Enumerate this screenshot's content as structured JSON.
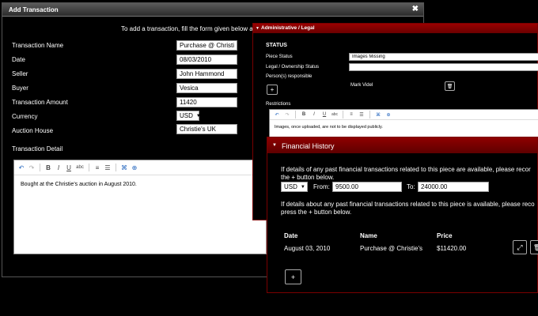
{
  "add_dialog": {
    "title": "Add Transaction",
    "close_glyph": "✖",
    "instructions": "To add a transaction, fill the form given below and click",
    "fields": {
      "name_label": "Transaction Name",
      "name_value": "Purchase @ Christie's",
      "date_label": "Date",
      "date_value": "08/03/2010",
      "seller_label": "Seller",
      "seller_value": "John Hammond",
      "buyer_label": "Buyer",
      "buyer_value": "Vesica",
      "amount_label": "Transaction Amount",
      "amount_value": "11420",
      "currency_label": "Currency",
      "currency_value": "USD",
      "house_label": "Auction House",
      "house_value": "Christie's UK"
    },
    "detail_label": "Transaction Detail",
    "detail_text": "Bought at the Christie's auction in August 2010."
  },
  "admin_panel": {
    "title": "Administrative / Legal",
    "section_title": "STATUS",
    "piece_status_label": "Piece Status",
    "piece_status_value": "Images Missing",
    "legal_label": "Legal / Ownership Status",
    "legal_value": "",
    "persons_label": "Person(s) responsible",
    "person_name": "Mark Videl",
    "restrictions_label": "Restrictions",
    "restrictions_text": "Images, once uploaded, are not to be displayed publicly."
  },
  "financial_panel": {
    "title": "Financial History",
    "intro_line1": "If details of any past financial transactions related to this piece are available, please recor",
    "intro_line2": "the + button below.",
    "currency_value": "USD",
    "from_label": "From:",
    "from_value": "9500.00",
    "to_label": "To:",
    "to_value": "24000.00",
    "info_line1": "If details about any past financial transactions related to this piece is available, please reco",
    "info_line2": "press the + button below.",
    "table": {
      "headers": [
        "Date",
        "Name",
        "Price"
      ],
      "rows": [
        {
          "date": "August 03, 2010",
          "name": "Purchase @ Christie's",
          "price": "$11420.00"
        }
      ]
    }
  },
  "toolbar": {
    "undo": "↶",
    "redo": "↷",
    "bold": "B",
    "italic": "I",
    "underline": "U",
    "strike": "abc",
    "ordered_list": "≡",
    "unordered_list": "☰",
    "link": "⌘",
    "image": "⊕"
  },
  "icons": {
    "plus": "+",
    "expand": "⤢",
    "trash": "🗑"
  },
  "colors": {
    "accent_red": "#8a0000",
    "background": "#000000"
  }
}
